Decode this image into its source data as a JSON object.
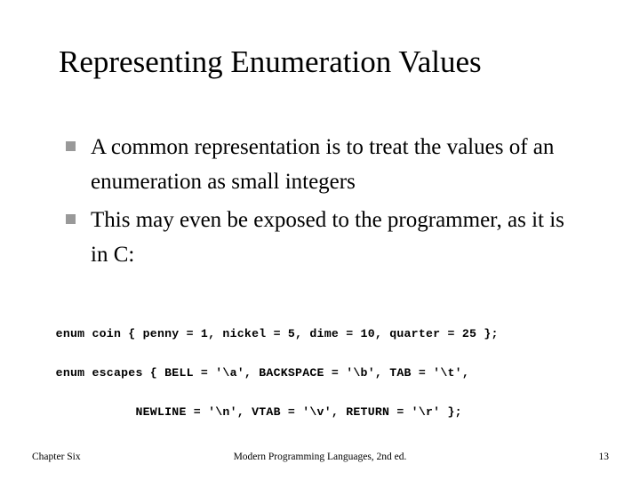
{
  "slide": {
    "title": "Representing Enumeration Values",
    "bullets": [
      {
        "marker": "square-bullet",
        "text": "A common representation is to treat the values of an enumeration as small integers"
      },
      {
        "marker": "square-bullet",
        "text": "This may even be exposed to the programmer, as it is in C:"
      }
    ],
    "code_blocks": [
      {
        "line": "enum coin { penny = 1, nickel = 5, dime = 10, quarter = 25 };"
      },
      {
        "line": "enum escapes { BELL = '\\a', BACKSPACE = '\\b', TAB = '\\t',",
        "continuation": "               NEWLINE = '\\n', VTAB = '\\v', RETURN = '\\r' };"
      }
    ],
    "footer": {
      "left": "Chapter Six",
      "center": "Modern Programming Languages, 2nd ed.",
      "right": "13"
    },
    "colors": {
      "background": "#ffffff",
      "text": "#000000",
      "bullet_marker": "#999999"
    }
  }
}
